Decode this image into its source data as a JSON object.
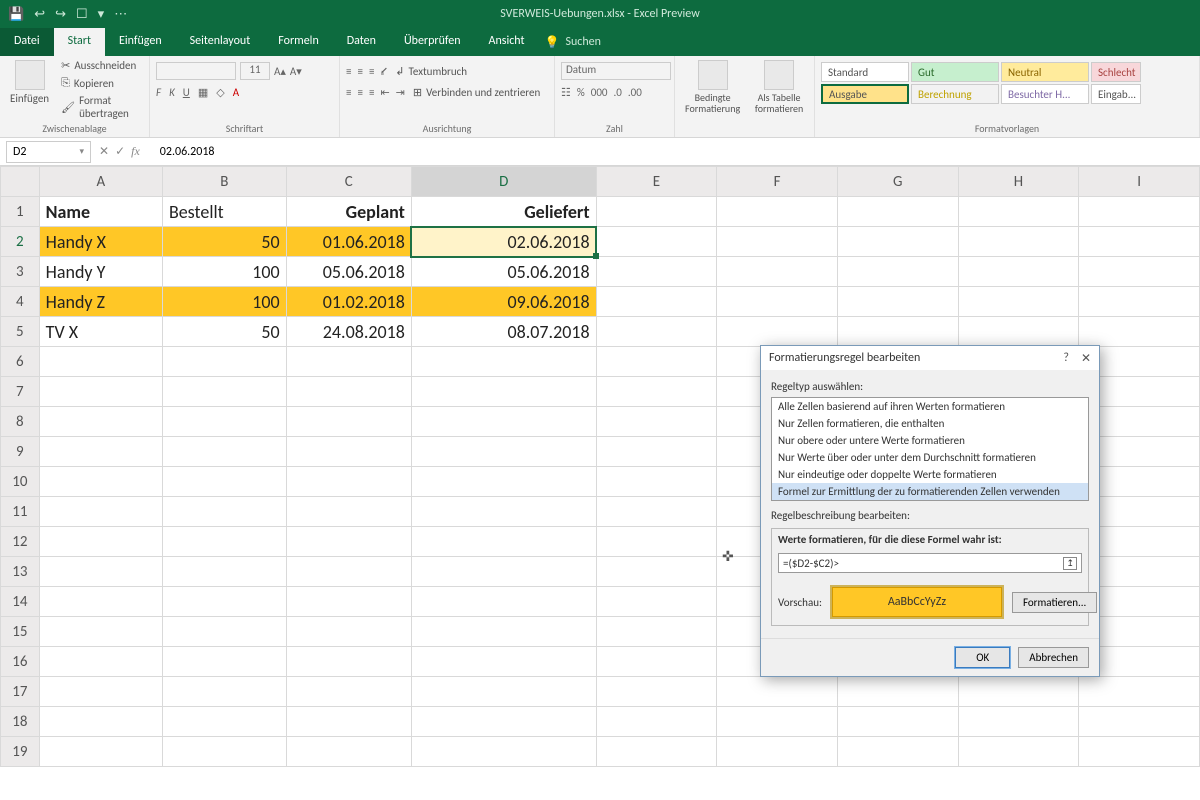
{
  "title": "SVERWEIS-Uebungen.xlsx - Excel Preview",
  "tabs": {
    "file": "Datei",
    "start": "Start",
    "einfuegen": "Einfügen",
    "seitenlayout": "Seitenlayout",
    "formeln": "Formeln",
    "daten": "Daten",
    "ueberpruefen": "Überprüfen",
    "ansicht": "Ansicht",
    "search": "Suchen"
  },
  "ribbon": {
    "paste": "Einfügen",
    "cut": "Ausschneiden",
    "copy": "Kopieren",
    "formatpainter": "Format übertragen",
    "clipboard": "Zwischenablage",
    "font": "Schriftart",
    "align": "Ausrichtung",
    "number": "Zahl",
    "numformat": "Datum",
    "wrap": "Textumbruch",
    "merge": "Verbinden und zentrieren",
    "cond": "Bedingte Formatierung",
    "table": "Als Tabelle formatieren",
    "styles_label": "Formatvorlagen",
    "fontsize": "11",
    "styles": [
      "Standard",
      "Gut",
      "Neutral",
      "Schlecht",
      "Ausgabe",
      "Berechnung",
      "Besuchter H...",
      "Eingab..."
    ]
  },
  "namebox": "D2",
  "formula": "02.06.2018",
  "columns": [
    "A",
    "B",
    "C",
    "D",
    "E",
    "F",
    "G",
    "H",
    "I"
  ],
  "rows": [
    "1",
    "2",
    "3",
    "4",
    "5",
    "6",
    "7",
    "8",
    "9",
    "10",
    "11",
    "12",
    "13",
    "14",
    "15",
    "16",
    "17",
    "18",
    "19"
  ],
  "sheet": {
    "headers": {
      "A": "Name",
      "B": "Bestellt",
      "C": "Geplant",
      "D": "Geliefert"
    },
    "r2": {
      "A": "Handy X",
      "B": "50",
      "C": "01.06.2018",
      "D": "02.06.2018"
    },
    "r3": {
      "A": "Handy Y",
      "B": "100",
      "C": "05.06.2018",
      "D": "05.06.2018"
    },
    "r4": {
      "A": "Handy Z",
      "B": "100",
      "C": "01.02.2018",
      "D": "09.06.2018"
    },
    "r5": {
      "A": "TV X",
      "B": "50",
      "C": "24.08.2018",
      "D": "08.07.2018"
    }
  },
  "dialog": {
    "title": "Formatierungsregel bearbeiten",
    "ruletype_lbl": "Regeltyp auswählen:",
    "rules": [
      "Alle Zellen basierend auf ihren Werten formatieren",
      "Nur Zellen formatieren, die enthalten",
      "Nur obere oder untere Werte formatieren",
      "Nur Werte über oder unter dem Durchschnitt formatieren",
      "Nur eindeutige oder doppelte Werte formatieren",
      "Formel zur Ermittlung der zu formatierenden Zellen verwenden"
    ],
    "desc_lbl": "Regelbeschreibung bearbeiten:",
    "formula_lbl": "Werte formatieren, für die diese Formel wahr ist:",
    "formula_val": "=($D2-$C2)>",
    "preview_lbl": "Vorschau:",
    "preview_sample": "AaBbCcYyZz",
    "format_btn": "Formatieren...",
    "ok": "OK",
    "cancel": "Abbrechen"
  }
}
